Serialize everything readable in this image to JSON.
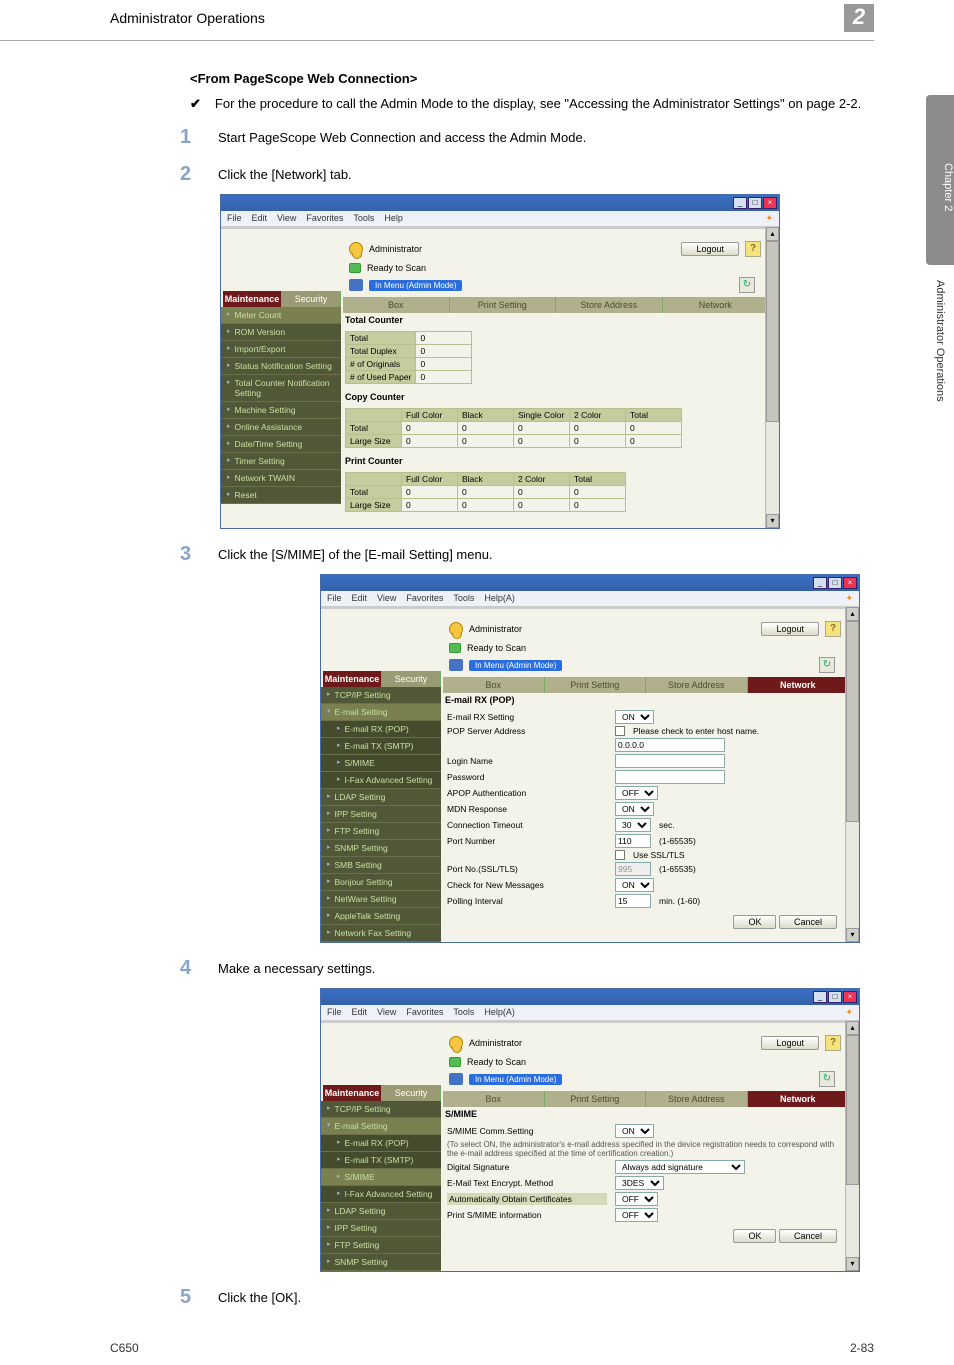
{
  "side_tab": "Chapter 2",
  "side_text": "Administrator Operations",
  "header": {
    "title": "Administrator Operations",
    "num": "2"
  },
  "sect_from": "<From PageScope Web Connection>",
  "check_text": "For the procedure to call the Admin Mode to the display, see \"Accessing the Administrator Settings\" on page 2-2.",
  "steps": {
    "s1": "Start PageScope Web Connection and access the Admin Mode.",
    "s2": "Click the [Network] tab.",
    "s3": "Click the [S/MIME] of the [E-mail Setting] menu.",
    "s4": "Make a necessary settings.",
    "s5": "Click the [OK]."
  },
  "nums": {
    "n1": "1",
    "n2": "2",
    "n3": "3",
    "n4": "4",
    "n5": "5"
  },
  "browser": {
    "menu": {
      "file": "File",
      "edit": "Edit",
      "view": "View",
      "fav": "Favorites",
      "tools": "Tools",
      "help": "Help",
      "helpA": "Help(A)"
    },
    "admin_label": "Administrator",
    "ready": "Ready to Scan",
    "mode": "In Menu (Admin Mode)",
    "logout": "Logout",
    "help_q": "?",
    "refresh": "↻",
    "tabs": {
      "maint": "Maintenance",
      "sec": "Security",
      "box": "Box",
      "print": "Print Setting",
      "store": "Store Address",
      "net": "Network"
    }
  },
  "shot1": {
    "side": [
      "Meter Count",
      "ROM Version",
      "Import/Export",
      "Status Notification Setting",
      "Total Counter Notification Setting",
      "Machine Setting",
      "Online Assistance",
      "Date/Time Setting",
      "Timer Setting",
      "Network TWAIN",
      "Reset"
    ],
    "h_total": "Total Counter",
    "h_copy": "Copy Counter",
    "h_print": "Print Counter",
    "rows_total": [
      {
        "l": "Total",
        "v": "0"
      },
      {
        "l": "Total Duplex",
        "v": "0"
      },
      {
        "l": "# of Originals",
        "v": "0"
      },
      {
        "l": "# of Used Paper",
        "v": "0"
      }
    ],
    "copy_h": [
      "",
      "Full Color",
      "Black",
      "Single Color",
      "2 Color",
      "Total"
    ],
    "copy_r": [
      [
        "Total",
        "0",
        "0",
        "0",
        "0",
        "0"
      ],
      [
        "Large Size",
        "0",
        "0",
        "0",
        "0",
        "0"
      ]
    ],
    "print_h": [
      "",
      "Full Color",
      "Black",
      "2 Color",
      "Total"
    ],
    "print_r": [
      [
        "Total",
        "0",
        "0",
        "0",
        "0"
      ],
      [
        "Large Size",
        "0",
        "0",
        "0",
        "0"
      ]
    ]
  },
  "shot2": {
    "side_top": "TCP/IP Setting",
    "side_open": "E-mail Setting",
    "side_sub": [
      "E-mail RX (POP)",
      "E-mail TX (SMTP)",
      "S/MIME",
      "I-Fax Advanced Setting"
    ],
    "side_rest": [
      "LDAP Setting",
      "IPP Setting",
      "FTP Setting",
      "SNMP Setting",
      "SMB Setting",
      "Bonjour Setting",
      "NetWare Setting",
      "AppleTalk Setting",
      "Network Fax Setting"
    ],
    "panel_h": "E-mail RX (POP)",
    "rows": [
      {
        "l": "E-mail RX Setting",
        "t": "sel",
        "v": "ON"
      },
      {
        "l": "POP Server Address",
        "t": "chk",
        "txt": "Please check to enter host name.",
        "v": "0.0.0.0"
      },
      {
        "l": "Login Name",
        "t": "inp",
        "v": ""
      },
      {
        "l": "Password",
        "t": "inp",
        "v": ""
      },
      {
        "l": "APOP Authentication",
        "t": "sel",
        "v": "OFF"
      },
      {
        "l": "MDN Response",
        "t": "sel",
        "v": "ON"
      },
      {
        "l": "Connection Timeout",
        "t": "selunit",
        "v": "30",
        "u": "sec."
      },
      {
        "l": "Port Number",
        "t": "inpunit",
        "v": "110",
        "u": "(1-65535)"
      },
      {
        "l": "",
        "t": "chklbl",
        "txt": "Use SSL/TLS"
      },
      {
        "l": "Port No.(SSL/TLS)",
        "t": "inpunit_dis",
        "v": "995",
        "u": "(1-65535)"
      },
      {
        "l": "Check for New Messages",
        "t": "sel",
        "v": "ON"
      },
      {
        "l": "Polling Interval",
        "t": "inpunit",
        "v": "15",
        "u": "min. (1-60)"
      }
    ],
    "ok": "OK",
    "cancel": "Cancel"
  },
  "shot3": {
    "side_top": "TCP/IP Setting",
    "side_open": "E-mail Setting",
    "side_sub": [
      "E-mail RX (POP)",
      "E-mail TX (SMTP)",
      "S/MIME",
      "I-Fax Advanced Setting"
    ],
    "side_rest": [
      "LDAP Setting",
      "IPP Setting",
      "FTP Setting",
      "SNMP Setting"
    ],
    "panel_h": "S/MIME",
    "rows": [
      {
        "l": "S/MIME Comm.Setting",
        "t": "sel",
        "v": "ON"
      },
      {
        "note": "(To select ON, the administrator's e-mail address specified in the device registration needs to correspond with the e-mail address specified at the time of certification creation.)"
      },
      {
        "l": "Digital Signature",
        "t": "sel",
        "v": "Always add signature"
      },
      {
        "l": "E-Mail Text Encrypt. Method",
        "t": "sel",
        "v": "3DES"
      },
      {
        "l": "Automatically Obtain Certificates",
        "t": "sel",
        "v": "OFF"
      },
      {
        "l": "Print S/MIME information",
        "t": "sel",
        "v": "OFF"
      }
    ],
    "ok": "OK",
    "cancel": "Cancel"
  },
  "footer": {
    "left": "C650",
    "right": "2-83"
  }
}
